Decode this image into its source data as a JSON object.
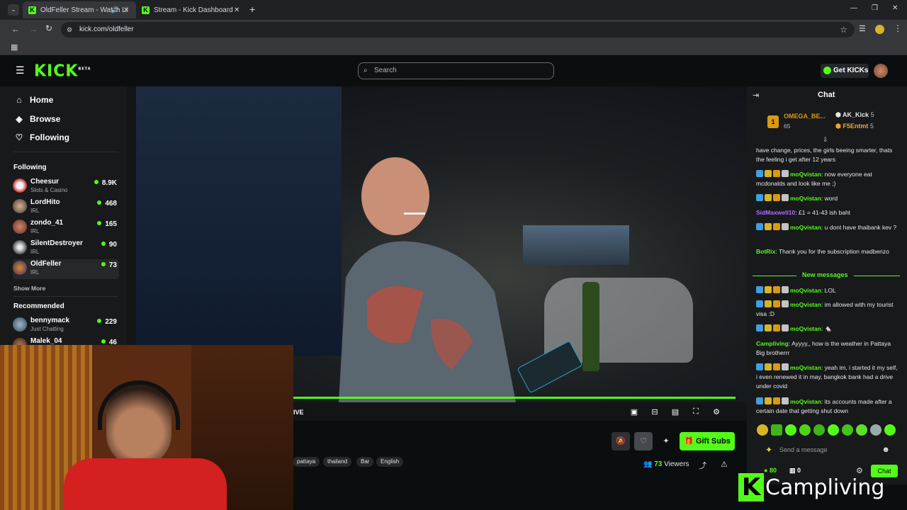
{
  "browser": {
    "tabs": [
      {
        "title": "OldFeller Stream - Watch Li",
        "active": true
      },
      {
        "title": "Stream - Kick Dashboard",
        "active": false
      }
    ],
    "url": "kick.com/oldfeller"
  },
  "header": {
    "logo": "KICK",
    "logo_sup": "BETA",
    "search_placeholder": "Search",
    "get_kicks": "Get KICKs",
    "accent": "#53fc18"
  },
  "sidebar": {
    "nav": [
      {
        "label": "Home",
        "icon": "home-icon"
      },
      {
        "label": "Browse",
        "icon": "compass-icon"
      },
      {
        "label": "Following",
        "icon": "heart-icon"
      }
    ],
    "following_title": "Following",
    "following": [
      {
        "name": "Cheesur",
        "category": "Slots & Casino",
        "viewers": "8.9K"
      },
      {
        "name": "LordHito",
        "category": "IRL",
        "viewers": "468"
      },
      {
        "name": "zondo_41",
        "category": "IRL",
        "viewers": "165"
      },
      {
        "name": "SilentDestroyer",
        "category": "IRL",
        "viewers": "90"
      },
      {
        "name": "OldFeller",
        "category": "IRL",
        "viewers": "73"
      }
    ],
    "show_more": "Show More",
    "recommended_title": "Recommended",
    "recommended": [
      {
        "name": "bennymack",
        "category": "Just Chatting",
        "viewers": "229"
      },
      {
        "name": "Malek_04",
        "category": "",
        "viewers": "46"
      }
    ]
  },
  "video": {
    "live_fragment": "IVE",
    "tags": [
      "pattaya",
      "thailand",
      "Bar",
      "English"
    ],
    "gift_subs": "Gift Subs",
    "viewers_count": "73",
    "viewers_label": "Viewers"
  },
  "chat": {
    "title": "Chat",
    "leaderboard": [
      {
        "name": "OMEGA_BE...",
        "count": "65"
      },
      {
        "name": "AK_Kick",
        "count": "5"
      },
      {
        "name": "F5Entmt",
        "count": "5"
      }
    ],
    "messages_before": [
      {
        "user": "",
        "text": "have change, prices, the girls beeing smarter, thats the feeling i get after 12 years",
        "color": "#e8e8e8"
      },
      {
        "user": "moQvistan",
        "text": "now everyone eat mcdonalds and look like me ;)",
        "color": "#53fc18"
      },
      {
        "user": "moQvistan",
        "text": "word",
        "color": "#53fc18"
      },
      {
        "user": "SidMaxwell10",
        "text": "£1 = 41-43 ish baht",
        "color": "#a970ff"
      },
      {
        "user": "moQvistan",
        "text": "u dont have thaibank kev ?",
        "color": "#53fc18"
      },
      {
        "user": "BotRix",
        "text": "Thank you for the subscription madbenzo",
        "color": "#53fc18"
      }
    ],
    "new_messages": "New messages",
    "messages_after": [
      {
        "user": "moQvistan",
        "text": "LOL",
        "color": "#53fc18"
      },
      {
        "user": "moQvistan",
        "text": "im allowed with my tourist visa :D",
        "color": "#53fc18"
      },
      {
        "user": "moQvistan",
        "text": "🐁",
        "color": "#53fc18"
      },
      {
        "user": "Campliving",
        "text": "Ayyyy,, how is the weather in Pattaya Big brotherrr",
        "color": "#53fc18"
      },
      {
        "user": "moQvistan",
        "text": "yeah im, i started it my self, i even renewed it in may, bangkok bank had a drive under covid",
        "color": "#53fc18"
      },
      {
        "user": "moQvistan",
        "text": "its accounts made after a certain date that getting shut down",
        "color": "#53fc18"
      }
    ],
    "send_placeholder": "Send a message",
    "points": "80",
    "gifts": "0",
    "chat_button": "Chat"
  },
  "watermark": "Campliving"
}
